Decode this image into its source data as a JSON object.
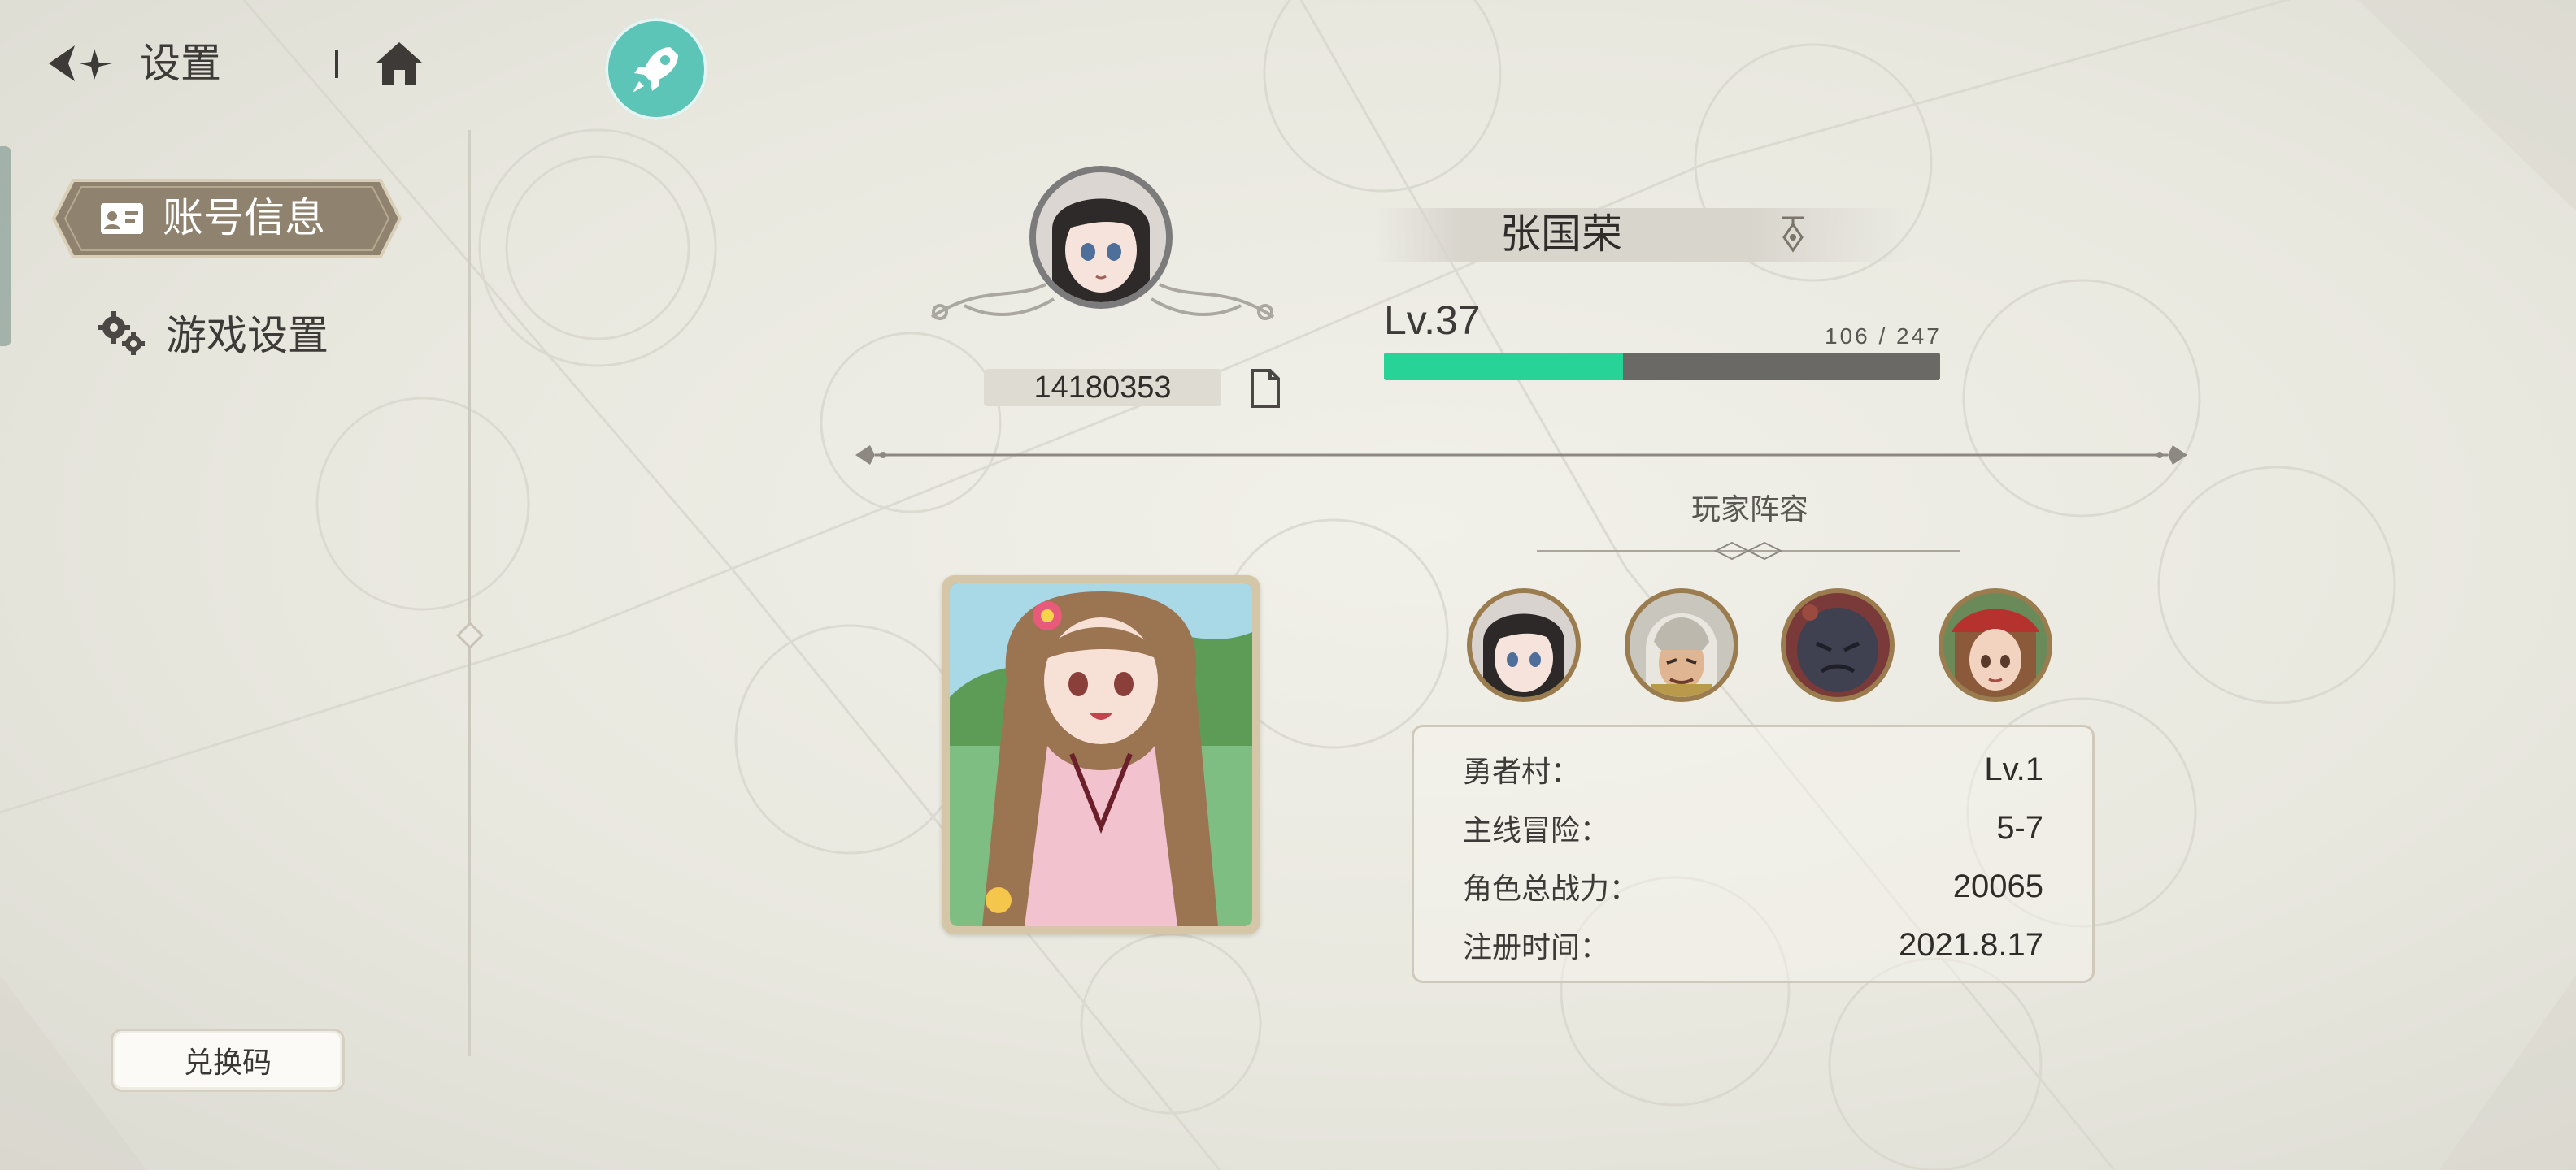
{
  "header": {
    "title": "设置",
    "back_icon": "back-arrow-icon",
    "home_icon": "home-icon",
    "quick_icon": "rocket-icon",
    "accent": "#5cc5b8"
  },
  "sidebar": {
    "items": [
      {
        "label": "账号信息",
        "icon": "id-card-icon",
        "active": true
      },
      {
        "label": "游戏设置",
        "icon": "gears-icon",
        "active": false
      }
    ],
    "redeem_label": "兑换码"
  },
  "profile": {
    "uid": "14180353",
    "name": "张国荣",
    "level": "Lv.37",
    "exp_text": "106 / 247",
    "exp_fraction": 0.43,
    "exp_color": "#27d396"
  },
  "lineup": {
    "title": "玩家阵容",
    "heroes": [
      "hero-portrait-1",
      "hero-portrait-2",
      "hero-portrait-3",
      "hero-portrait-4"
    ]
  },
  "stats": [
    {
      "label": "勇者村：",
      "value": "Lv.1"
    },
    {
      "label": "主线冒险：",
      "value": "5-7"
    },
    {
      "label": "角色总战力：",
      "value": "20065"
    },
    {
      "label": "注册时间：",
      "value": "2021.8.17"
    }
  ]
}
